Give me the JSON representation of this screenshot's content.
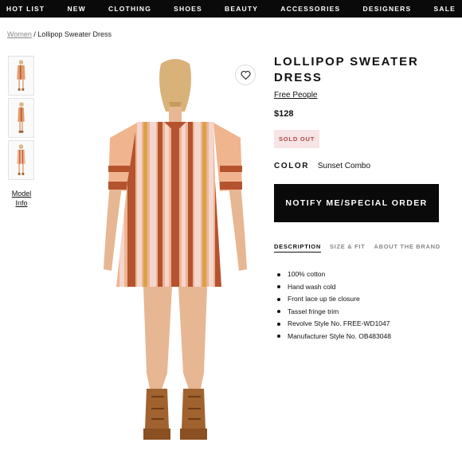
{
  "nav": {
    "items": [
      "HOT LIST",
      "NEW",
      "CLOTHING",
      "SHOES",
      "BEAUTY",
      "ACCESSORIES",
      "DESIGNERS",
      "SALE"
    ]
  },
  "breadcrumb": {
    "parent": "Women",
    "separator": "/",
    "current": "Lollipop Sweater Dress"
  },
  "gallery": {
    "model_info_line1": "Model",
    "model_info_line2": "Info"
  },
  "product": {
    "title": "LOLLIPOP SWEATER DRESS",
    "brand": "Free People",
    "price": "$128",
    "badge": "SOLD OUT",
    "color_label": "COLOR",
    "color_value": "Sunset Combo",
    "cta": "NOTIFY ME/SPECIAL ORDER"
  },
  "tabs": {
    "description": "DESCRIPTION",
    "size_fit": "SIZE & FIT",
    "about_brand": "ABOUT THE BRAND"
  },
  "description_items": [
    "100% cotton",
    "Hand wash cold",
    "Front lace up tie closure",
    "Tassel fringe trim",
    "Revolve Style No. FREE-WD1047",
    "Manufacturer Style No. OB483048"
  ],
  "colors": {
    "nav_bg": "#0a0a0a",
    "sold_out_bg": "#f7e4e4",
    "sold_out_text": "#b04a4a",
    "stripe_rust": "#b5532f",
    "stripe_peach": "#f0b48f",
    "stripe_pink": "#f3d6cf",
    "stripe_gold": "#d9a24a"
  },
  "icons": {
    "wishlist": "heart-icon"
  }
}
